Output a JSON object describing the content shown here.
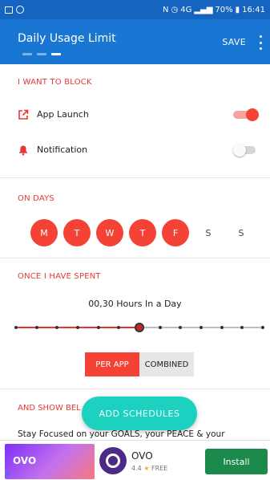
{
  "status_bar": {
    "battery": "70%",
    "time": "16:41",
    "network": "4G"
  },
  "app_bar": {
    "title": "Daily Usage Limit",
    "save_label": "SAVE"
  },
  "block_section": {
    "title": "I WANT TO BLOCK",
    "items": [
      {
        "label": "App Launch",
        "icon": "open-in-new-icon",
        "enabled": true
      },
      {
        "label": "Notification",
        "icon": "bell-icon",
        "enabled": false
      }
    ]
  },
  "days_section": {
    "title": "ON DAYS",
    "days": [
      {
        "label": "M",
        "selected": true
      },
      {
        "label": "T",
        "selected": true
      },
      {
        "label": "W",
        "selected": true
      },
      {
        "label": "T",
        "selected": true
      },
      {
        "label": "F",
        "selected": true
      },
      {
        "label": "S",
        "selected": false
      },
      {
        "label": "S",
        "selected": false
      }
    ]
  },
  "spent_section": {
    "title": "ONCE I HAVE SPENT",
    "value_text": "00,30 Hours In a Day",
    "slider": {
      "steps": 13,
      "selected_index": 6
    },
    "mode_options": [
      "PER APP",
      "COMBINED"
    ],
    "selected_mode": "PER APP"
  },
  "show_section": {
    "title": "AND SHOW BEL",
    "message": "Stay Focused on your GOALS, your PEACE & your"
  },
  "fab_label": "ADD SCHEDULES",
  "ad": {
    "banner_text": "OVO",
    "app_name": "OVO",
    "rating": "4.4",
    "price": "FREE",
    "install_label": "Install"
  },
  "colors": {
    "primary": "#1976d2",
    "accent": "#f44336",
    "fab": "#1dd1c0",
    "install": "#1b8a4a"
  }
}
